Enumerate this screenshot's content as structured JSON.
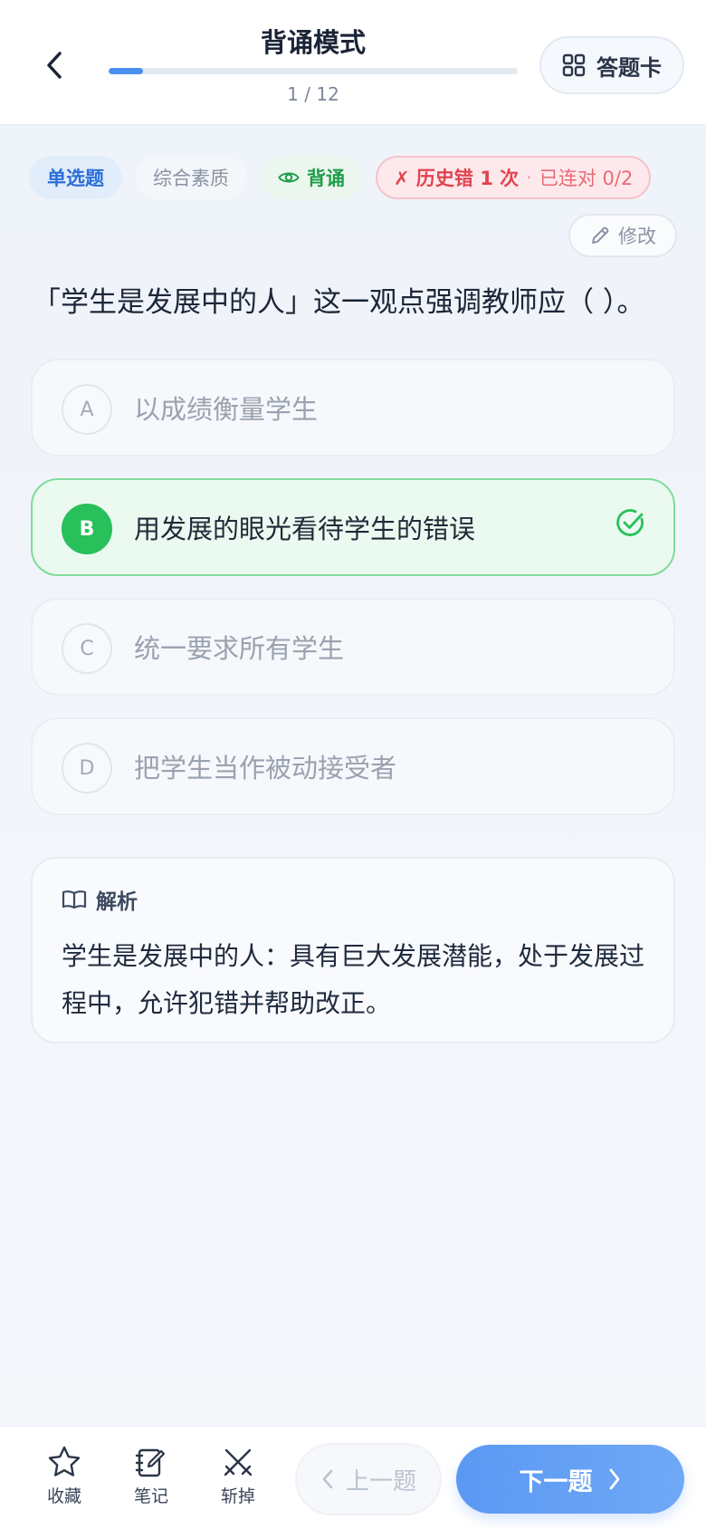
{
  "header": {
    "title": "背诵模式",
    "progress_text": "1 / 12",
    "progress_fraction": 0.0833,
    "answer_card_label": "答题卡",
    "back_icon": "chevron-left-icon",
    "answer_card_icon": "grid-icon"
  },
  "tags": {
    "type": "单选题",
    "subject": "综合素质",
    "mode": "背诵",
    "history_wrong": "✗ 历史错 1 次",
    "history_separator": "·",
    "history_streak": "已连对 0/2"
  },
  "edit_label": "修改",
  "question": "「学生是发展中的人」这一观点强调教师应（ ）。",
  "options": [
    {
      "letter": "A",
      "text": "以成绩衡量学生",
      "correct": false
    },
    {
      "letter": "B",
      "text": "用发展的眼光看待学生的错误",
      "correct": true
    },
    {
      "letter": "C",
      "text": "统一要求所有学生",
      "correct": false
    },
    {
      "letter": "D",
      "text": "把学生当作被动接受者",
      "correct": false
    }
  ],
  "analysis": {
    "title": "解析",
    "body": "学生是发展中的人：具有巨大发展潜能，处于发展过程中，允许犯错并帮助改正。"
  },
  "bottom": {
    "favorite_label": "收藏",
    "note_label": "笔记",
    "remove_label": "斩掉",
    "prev_label": "上一题",
    "next_label": "下一题"
  },
  "colors": {
    "accent": "#4a8ff0",
    "correct": "#27c05a",
    "error": "#e2434f"
  }
}
